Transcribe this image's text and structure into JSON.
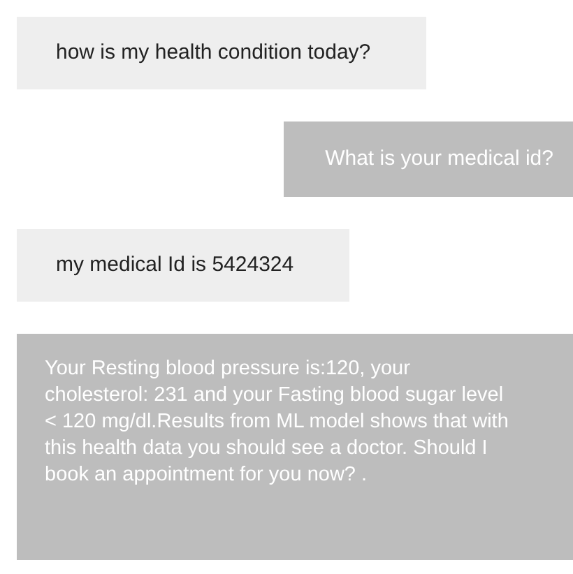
{
  "messages": [
    {
      "kind": "user",
      "text": "how is my health condition today?"
    },
    {
      "kind": "bot",
      "text": "What is your medical id?"
    },
    {
      "kind": "user",
      "text": "my medical Id is 5424324"
    },
    {
      "kind": "bot",
      "text": "Your Resting blood pressure is:120, your cholesterol: 231 and your Fasting blood sugar level < 120 mg/dl.Results from ML model shows that with this health data you should see a doctor. Should I book an appointment for you now? ."
    }
  ]
}
